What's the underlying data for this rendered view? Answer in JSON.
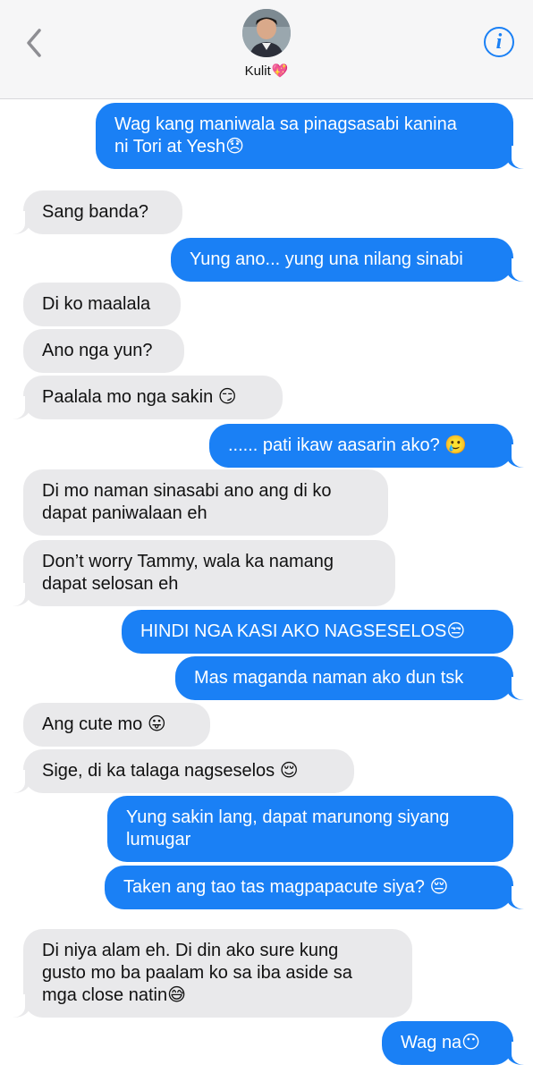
{
  "header": {
    "contact_name": "Kulit",
    "contact_emoji": "💖",
    "back_icon": "chevron-left-icon",
    "info_icon": "info-icon",
    "accent_color": "#1a80f5"
  },
  "messages": [
    {
      "from": "me",
      "lines": [
        "Wag kang maniwala sa pinagsasabi kanina",
        "ni Tori at Yesh😞"
      ]
    },
    {
      "from": "them",
      "lines": [
        "Sang banda?"
      ]
    },
    {
      "from": "me",
      "lines": [
        "Yung ano... yung una nilang sinabi"
      ]
    },
    {
      "from": "them",
      "lines": [
        "Di ko maalala"
      ]
    },
    {
      "from": "them",
      "lines": [
        "Ano nga yun?"
      ]
    },
    {
      "from": "them",
      "lines": [
        "Paalala mo nga sakin 😏"
      ]
    },
    {
      "from": "me",
      "lines": [
        "...... pati ikaw aasarin ako? 🥲"
      ]
    },
    {
      "from": "them",
      "lines": [
        "Di mo naman sinasabi ano ang di ko",
        "dapat paniwalaan eh"
      ]
    },
    {
      "from": "them",
      "lines": [
        "Don’t worry Tammy, wala ka namang",
        "dapat selosan eh"
      ]
    },
    {
      "from": "me",
      "lines": [
        "HINDI NGA KASI AKO NAGSESELOS😒"
      ]
    },
    {
      "from": "me",
      "lines": [
        "Mas maganda naman ako dun tsk"
      ]
    },
    {
      "from": "them",
      "lines": [
        "Ang cute mo 😛"
      ]
    },
    {
      "from": "them",
      "lines": [
        "Sige, di ka talaga nagseselos 😌"
      ]
    },
    {
      "from": "me",
      "lines": [
        "Yung sakin lang, dapat marunong siyang",
        "lumugar"
      ]
    },
    {
      "from": "me",
      "lines": [
        "Taken ang tao tas magpapacute siya? 😔"
      ]
    },
    {
      "from": "them",
      "lines": [
        "Di niya alam eh. Di din ako sure kung",
        "gusto mo ba paalam ko sa iba aside sa",
        "mga close natin😅"
      ]
    },
    {
      "from": "me",
      "lines": [
        "Wag na😶"
      ]
    }
  ]
}
